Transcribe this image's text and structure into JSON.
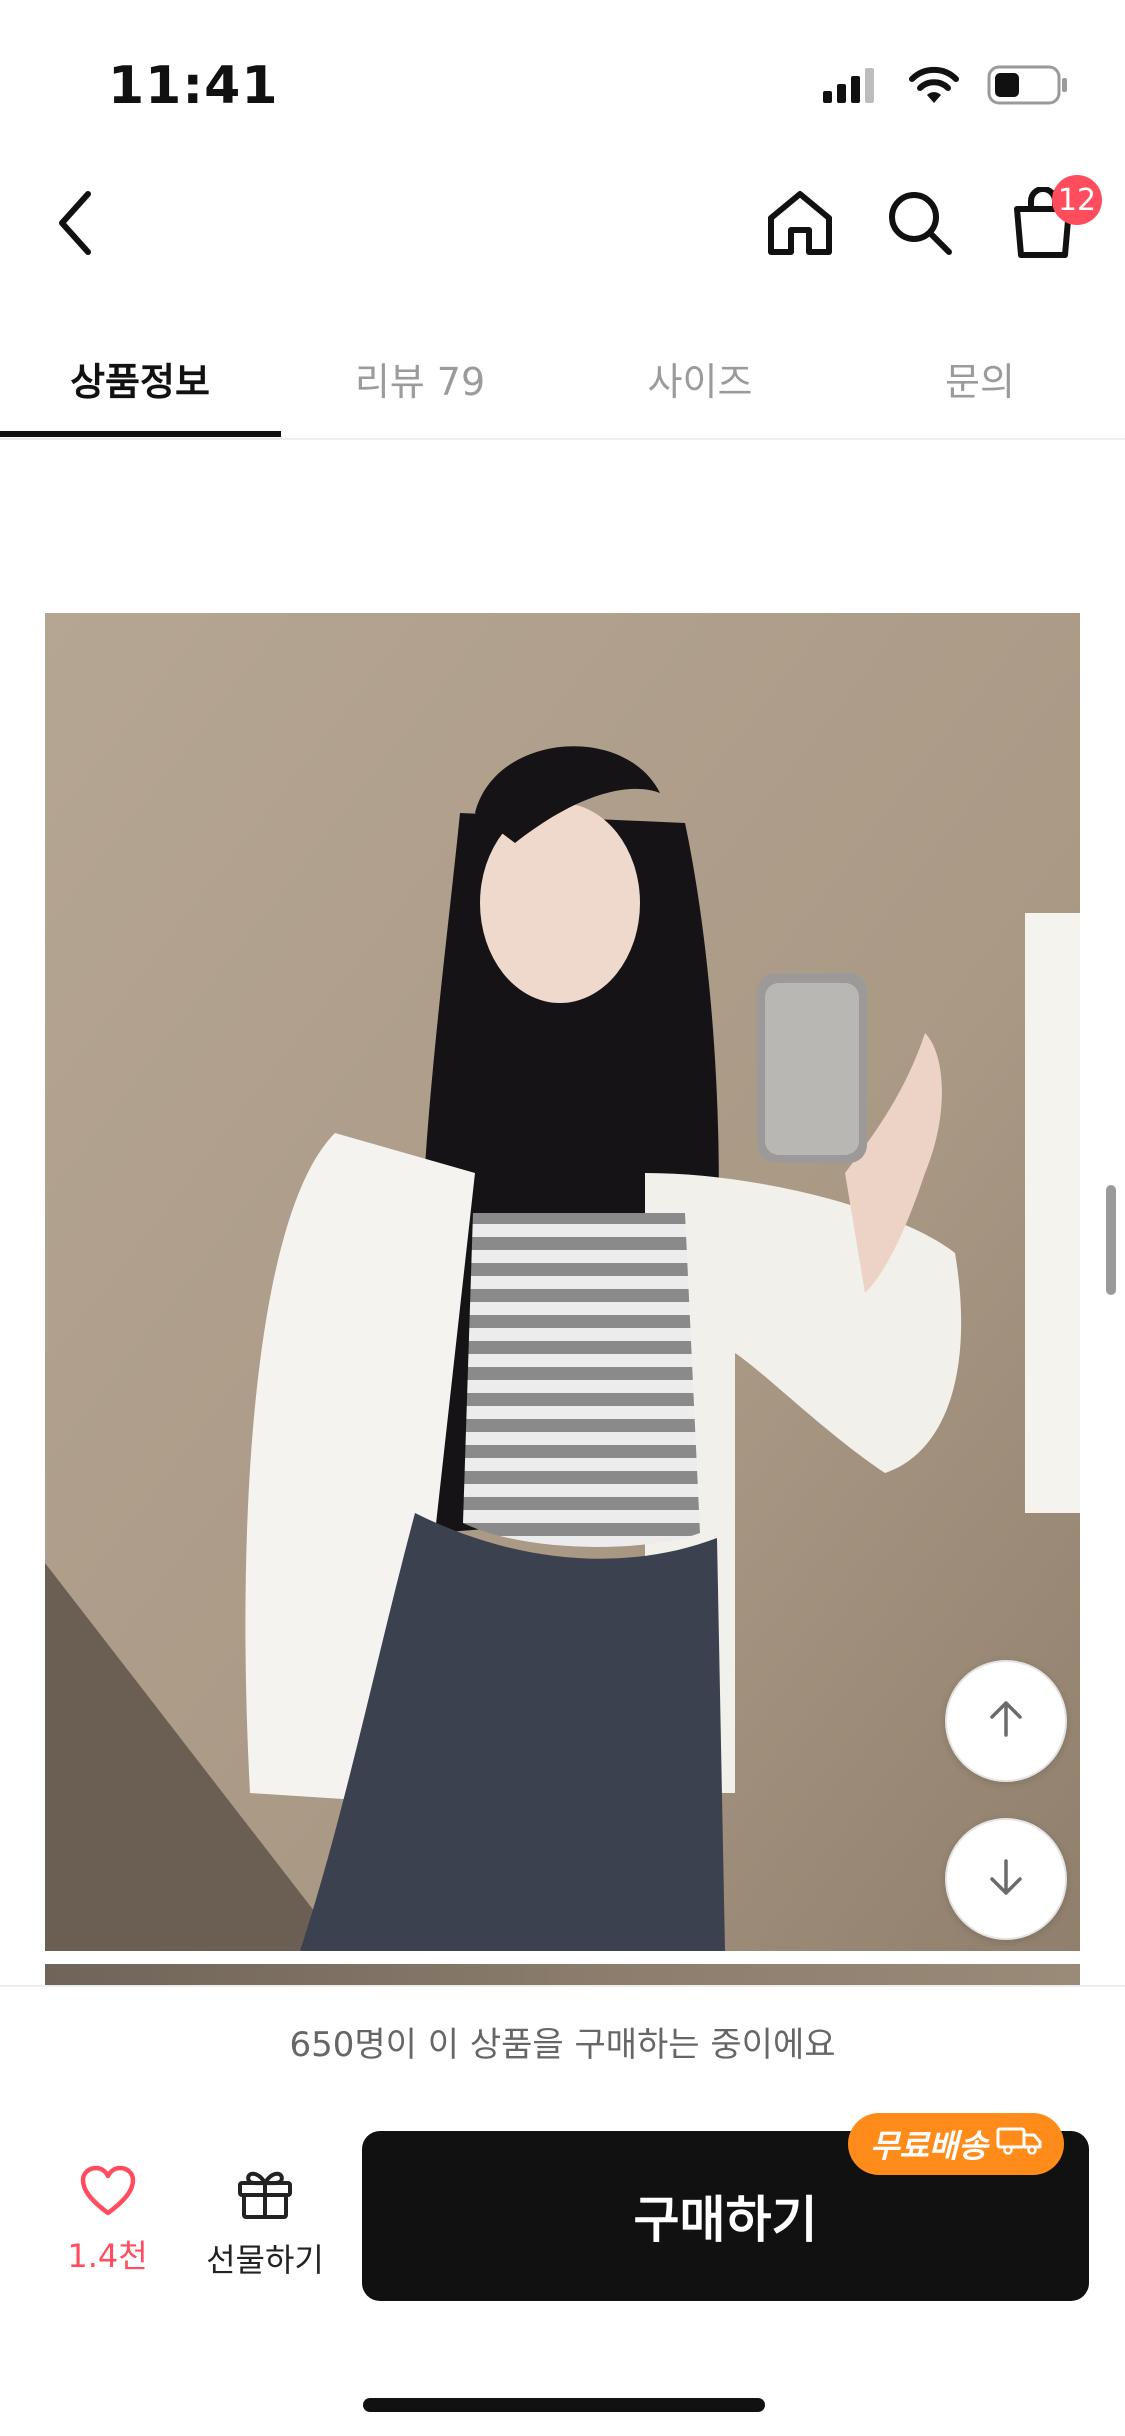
{
  "status_bar": {
    "time": "11:41"
  },
  "nav": {
    "cart_count": "12"
  },
  "tabs": [
    {
      "label": "상품정보",
      "active": true
    },
    {
      "label": "리뷰 79",
      "active": false
    },
    {
      "label": "사이즈",
      "active": false
    },
    {
      "label": "문의",
      "active": false
    }
  ],
  "product": {
    "image_icon": "product-photo"
  },
  "notice": {
    "text": "650명이 이 상품을 구매하는 중이에요"
  },
  "bottom": {
    "like_count": "1.4천",
    "gift_label": "선물하기",
    "buy_label": "구매하기",
    "free_shipping_label": "무료배송"
  },
  "colors": {
    "accent_red": "#ff4d5e",
    "shipping_orange": "#ff8c1a",
    "buy_button": "#111111"
  }
}
